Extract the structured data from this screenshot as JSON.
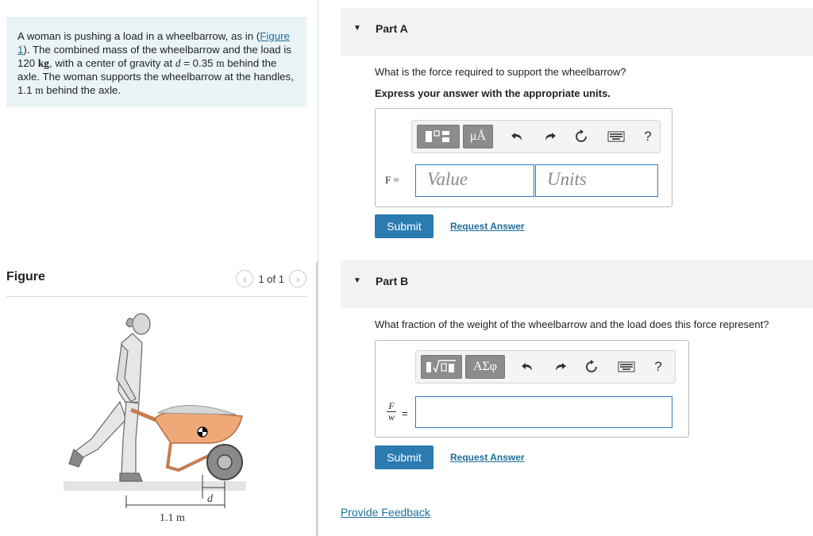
{
  "problem": {
    "text_1": "A woman is pushing a load in a wheelbarrow, as in (",
    "figure_link": "Figure 1",
    "text_2": "). The combined mass of the wheelbarrow and the load is 120 ",
    "unit_kg": "kg",
    "text_3": ", with a center of gravity at ",
    "d_symbol": "d",
    "text_4": " = 0.35 ",
    "unit_m": "m",
    "text_5": " behind the axle. The woman supports the wheelbarrow at the handles, 1.1 ",
    "unit_m2": "m",
    "text_6": " behind the axle."
  },
  "figure": {
    "title": "Figure",
    "pager_text": "1 of 1",
    "prev_icon": "chevron-left-icon",
    "next_icon": "chevron-right-icon",
    "label_d": "d",
    "label_dist": "1.1 m"
  },
  "part_a": {
    "title": "Part A",
    "question": "What is the force required to support the wheelbarrow?",
    "instruction": "Express your answer with the appropriate units.",
    "label": "F =",
    "value_placeholder": "Value",
    "units_placeholder": "Units",
    "units_btn": "μÅ",
    "help": "?",
    "submit": "Submit",
    "request": "Request Answer"
  },
  "part_b": {
    "title": "Part B",
    "question": "What fraction of the weight of the wheelbarrow and the load does this force represent?",
    "frac_num": "F",
    "frac_den": "w",
    "equals": "=",
    "greek_btn": "ΑΣφ",
    "help": "?",
    "submit": "Submit",
    "request": "Request Answer"
  },
  "feedback": "Provide Feedback",
  "colors": {
    "accent": "#2b7bb0",
    "link": "#1f6e9a",
    "problem_bg": "#eaf4f7",
    "wheelbarrow": "#f0a878"
  }
}
